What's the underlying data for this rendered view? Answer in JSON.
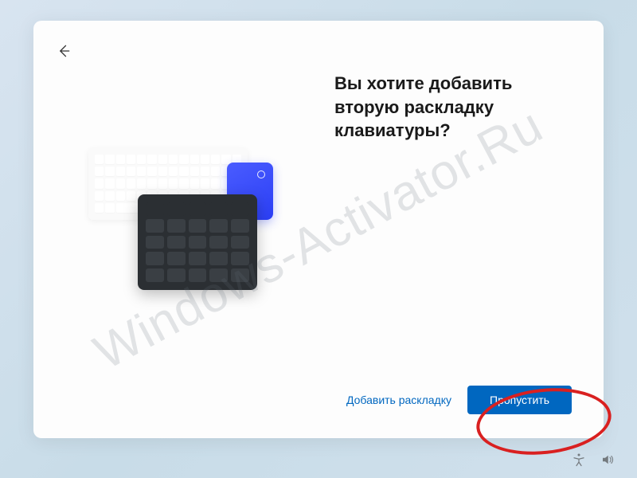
{
  "title": "Вы хотите добавить вторую раскладку клавиатуры?",
  "actions": {
    "add_layout": "Добавить раскладку",
    "skip": "Пропустить"
  },
  "watermark": "Windows-Activator.Ru",
  "icons": {
    "back": "back-arrow",
    "accessibility": "accessibility",
    "volume": "volume"
  }
}
